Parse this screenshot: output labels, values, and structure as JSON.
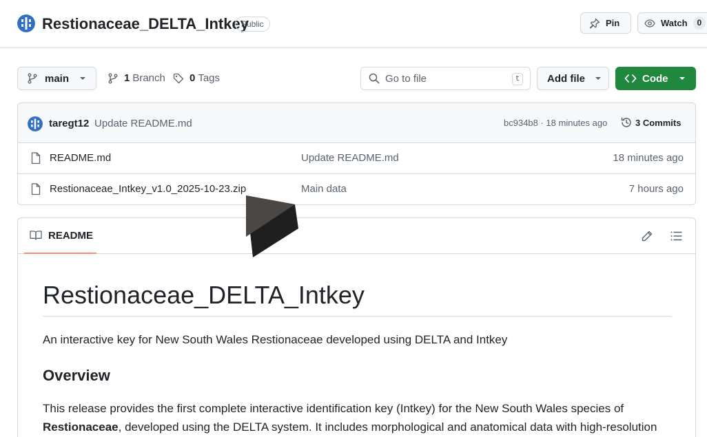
{
  "header": {
    "repo_name": "Restionaceae_DELTA_Intkey",
    "visibility": "Public",
    "pin_label": "Pin",
    "watch_label": "Watch",
    "watch_count": "0"
  },
  "toolbar": {
    "branch_name": "main",
    "branches_count": "1",
    "branches_label": "Branch",
    "tags_count": "0",
    "tags_label": "Tags",
    "goto_placeholder": "Go to file",
    "goto_shortcut": "t",
    "add_file_label": "Add file",
    "code_label": "Code"
  },
  "latest_commit": {
    "author": "taregt12",
    "message": "Update README.md",
    "meta": "bc934b8 · 18 minutes ago",
    "commits_label": "3 Commits"
  },
  "files": [
    {
      "name": "README.md",
      "commit": "Update README.md",
      "time": "18 minutes ago"
    },
    {
      "name": "Restionaceae_Intkey_v1.0_2025-10-23.zip",
      "commit": "Main data",
      "time": "7 hours ago"
    }
  ],
  "readme": {
    "tab_label": "README",
    "title": "Restionaceae_DELTA_Intkey",
    "intro": "An interactive key for New South Wales Restionaceae developed using DELTA and Intkey",
    "overview_heading": "Overview",
    "overview_pre": "This release provides the first complete interactive identification key (Intkey) for the New South Wales species of ",
    "overview_bold": "Restionaceae",
    "overview_post": ", developed using the DELTA system. It includes morphological and anatomical data with high-resolution"
  },
  "colors": {
    "accent_green": "#1f883d",
    "tab_underline": "#fd8c73",
    "border": "#d1d9e0",
    "muted_text": "#59636e"
  },
  "icons": [
    "repo-avatar-icon",
    "pin-icon",
    "eye-icon",
    "git-branch-icon",
    "tag-icon",
    "search-icon",
    "code-icon",
    "history-icon",
    "file-icon",
    "book-icon",
    "pencil-icon",
    "list-icon"
  ]
}
